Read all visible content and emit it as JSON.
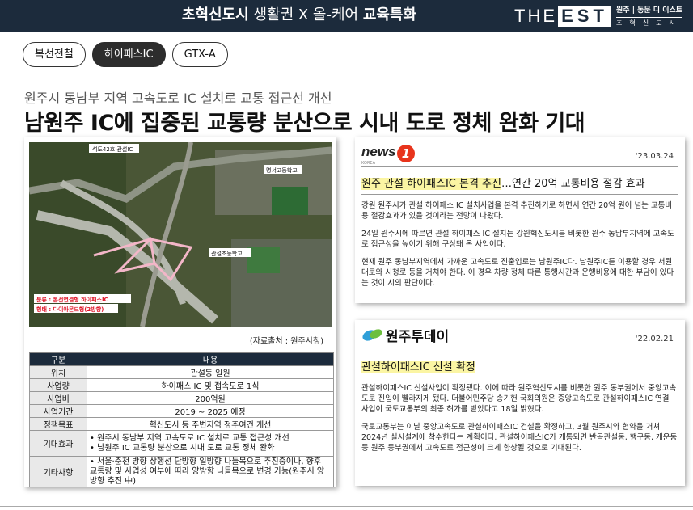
{
  "header": {
    "title_bold_1": "초혁신도시",
    "title_thin": " 생활권 X 올-케어 ",
    "title_bold_2": "교육특화",
    "brand_the": "THE",
    "brand_est": "EST",
    "brand_sub1": "원주 | 동문 디 이스트",
    "brand_sub2": "초혁신도시"
  },
  "tags": [
    "복선전철",
    "하이패스IC",
    "GTX-A"
  ],
  "active_tag": "하이패스IC",
  "subheadline": "원주시 동남부 지역 고속도로  IC 설치로 교통 접근선 개선",
  "headline": "남원주 IC에 집중된 교통량 분산으로 시내 도로 정체 완화 기대",
  "map": {
    "label_top": "석도42호 관설IC",
    "label_school1": "명서고등학교",
    "label_school2": "관설초등학교",
    "caption_line1": "분류 : 본선연결형 하이패스IC",
    "caption_line2": "형태 : 다이아몬드형(2방향)"
  },
  "source": "(자료출처 : 원주시청)",
  "table": {
    "headers": [
      "구분",
      "내용"
    ],
    "rows": [
      {
        "key": "위치",
        "value": "관설동 일원"
      },
      {
        "key": "사업량",
        "value": "하이패스 IC 및 접속도로 1식"
      },
      {
        "key": "사업비",
        "value": "200억원"
      },
      {
        "key": "사업기간",
        "value": "2019 ~ 2025 예정"
      },
      {
        "key": "정책목표",
        "value": "혁신도시 등 주변지역 정주여건 개선"
      }
    ],
    "effect_key": "기대효과",
    "effect_lines": [
      "• 원주시 동남부 지역 고속도로 IC 설치로 교통 접근성 개선",
      "• 남원주 IC 교통량 분산으로 시내 도로 교통 정체 완화"
    ],
    "etc_key": "기타사항",
    "etc_text": "• 서울·춘천 방향 상행선 단방향 일방향 나들목으로 추진중이나, 향후 교통량 및 사업성 여부에 따라 양방향 나들목으로 변경 가능(원주시 양방향 추진 中)"
  },
  "card1": {
    "logo_text": "news",
    "logo_number": "1",
    "logo_korea": "KOREA",
    "date": "'23.03.24",
    "headline_mark": "원주 관설 하이패스IC 본격 추진",
    "headline_rest": "…연간 20억 교통비용 절감 효과",
    "paragraphs": [
      "강원 원주시가 관설 하이패스 IC 설치사업을 본격 추진하기로 하면서 연간 20억 원이 넘는 교통비용 절감효과가 있을 것이라는 전망이 나왔다.",
      "24일 원주시에 따르면 관설 하이패스 IC 설치는 강원혁신도시를 비롯한 원주 동남부지역에 고속도로 접근성을 높이기 위해 구상돼 온 사업이다.",
      "현재 원주 동남부지역에서 가까운 고속도로 진출입로는 남원주IC다. 남원주IC를 이용할 경우 서원대로와 시청로 등을 거쳐야 한다. 이 경우 차량 정체 따른 통행시간과 운행비용에 대한 부담이 있다는 것이 시의 판단이다."
    ]
  },
  "card2": {
    "logo_name": "원주투데이",
    "date": "'22.02.21",
    "headline_mark": "관설하이패스IC 신설 확정",
    "paragraphs": [
      "관설하이패스IC 신설사업이 확정됐다. 이에 따라 원주혁신도시를 비롯한 원주 동부권에서 중앙고속도로 진입이 빨라지게 됐다. 더불어민주당 송기헌 국회의원은 중앙고속도로 관설하이패스IC 연결 사업이 국토교통부의 최종 허가를 받았다고 18일 밝혔다.",
      "국토교통부는 이날 중앙고속도로 관설하이패스IC 건설을 확정하고, 3월 원주시와 협약을 거쳐 2024년 실시설계에 착수한다는 계획이다. 관설하이패스IC가 개통되면 반곡관설동, 행구동, 개운동 등 원주 동부권에서 고속도로 접근성이 크게 향상될 것으로 기대된다."
    ]
  },
  "colors": {
    "navy": "#1c2b3c",
    "highlight": "#fbf5a3",
    "news1_red": "#e8341c",
    "route_pink": "#f3b6c8",
    "map_label_red": "#e0192b"
  }
}
